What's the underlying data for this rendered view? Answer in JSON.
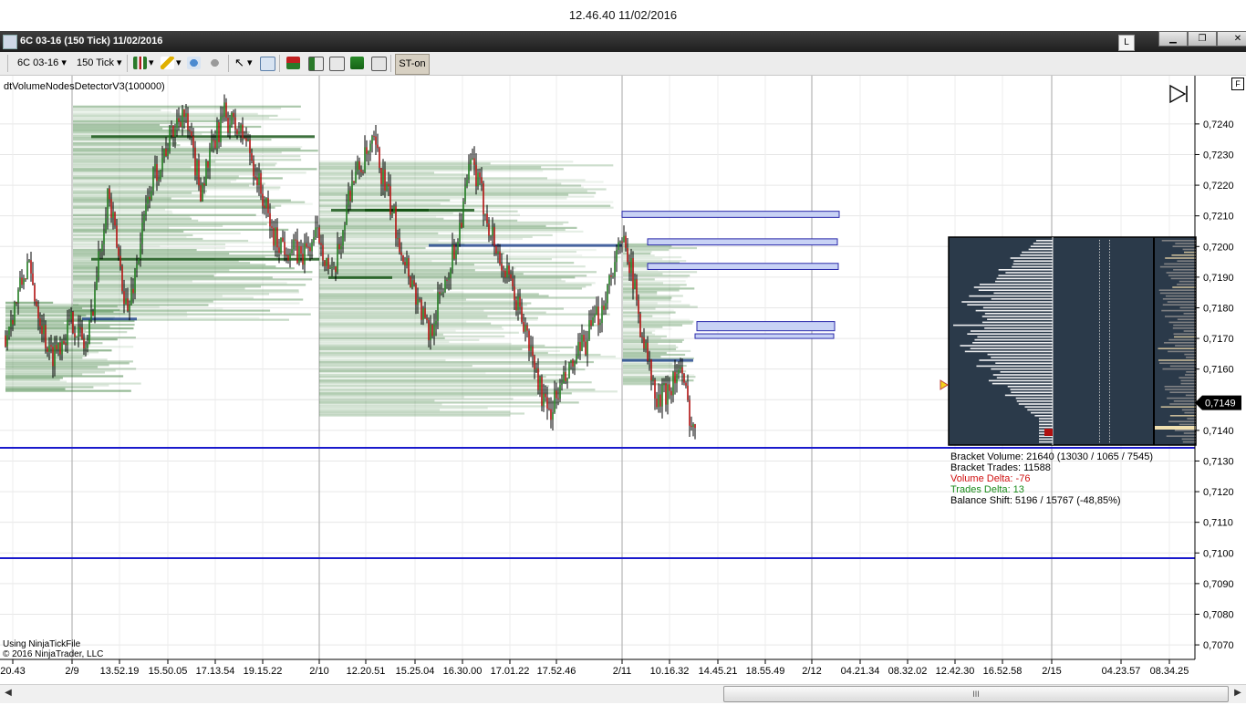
{
  "clock": "12.46.40 11/02/2016",
  "window": {
    "title": "6C 03-16 (150 Tick)  11/02/2016",
    "link_button": "L",
    "minimize": "▁",
    "restore": "❐",
    "close": "✕"
  },
  "toolbar": {
    "instrument": "6C 03-16",
    "interval": "150 Tick",
    "st_label": "ST-on"
  },
  "indicator_name": "dtVolumeNodesDetectorV3(100000)",
  "f_marker": "F",
  "copyright": {
    "line1": "Using NinjaTickFile",
    "line2": "© 2016 NinjaTrader, LLC"
  },
  "price_axis": {
    "ticks": [
      "0,7240",
      "0,7230",
      "0,7220",
      "0,7210",
      "0,7200",
      "0,7190",
      "0,7180",
      "0,7170",
      "0,7160",
      "0,7149",
      "0,7140",
      "0,7130",
      "0,7120",
      "0,7110",
      "0,7100",
      "0,7090",
      "0,7080",
      "0,7070"
    ],
    "current_price": "0,7149"
  },
  "time_axis": {
    "labels": [
      "20.43",
      "2/9",
      "13.52.19",
      "15.50.05",
      "17.13.54",
      "19.15.22",
      "2/10",
      "12.20.51",
      "15.25.04",
      "16.30.00",
      "17.01.22",
      "17.52.46",
      "2/11",
      "10.16.32",
      "14.45.21",
      "18.55.49",
      "2/12",
      "04.21.34",
      "08.32.02",
      "12.42.30",
      "16.52.58",
      "2/15",
      "04.23.57",
      "08.34.25"
    ]
  },
  "bracket_stats": {
    "volume": "Bracket Volume: 21640 (13030 / 1065 / 7545)",
    "trades": "Bracket Trades: 11588",
    "volume_delta": "Volume Delta: -76",
    "trades_delta": "Trades Delta: 13",
    "balance_shift": "Balance Shift: 5196 / 15767 (-48,85%)"
  },
  "colors": {
    "up_candle": "#1f7a1f",
    "down_candle": "#b01010",
    "volume_node": "#1d6b1d",
    "level_line": "#1a1acc",
    "zone_fill": "#c8d2f5",
    "profile_bg": "#2b3a4a"
  },
  "scrollbar": {
    "grip": "III",
    "left_arrow": "◀",
    "right_arrow": "▶"
  }
}
